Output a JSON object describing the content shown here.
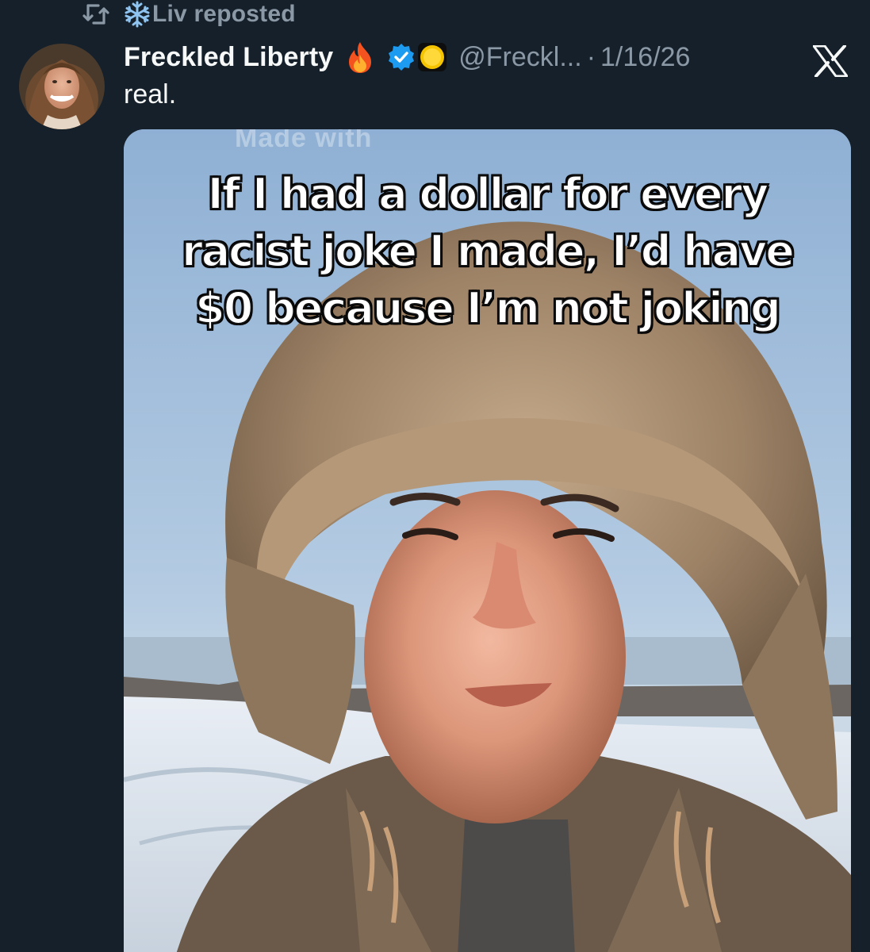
{
  "repost": {
    "label": "Liv reposted",
    "icon": "repost-icon",
    "emoji": "snowflake"
  },
  "post": {
    "display_name": "Freckled Liberty",
    "name_emoji": "🔥",
    "handle": "@Freckl...",
    "separator": "·",
    "date": "1/16/26",
    "text": "real.",
    "platform_icon": "x-logo"
  },
  "media": {
    "watermark": "Made with",
    "caption_lines": [
      "If I had a dollar for every",
      "racist joke I made, I’d have",
      "$0 because I’m not joking"
    ]
  },
  "colors": {
    "background": "#15202b",
    "text_primary": "#f7f9f9",
    "text_secondary": "#8b98a5",
    "verified_blue": "#1d9bf0"
  }
}
